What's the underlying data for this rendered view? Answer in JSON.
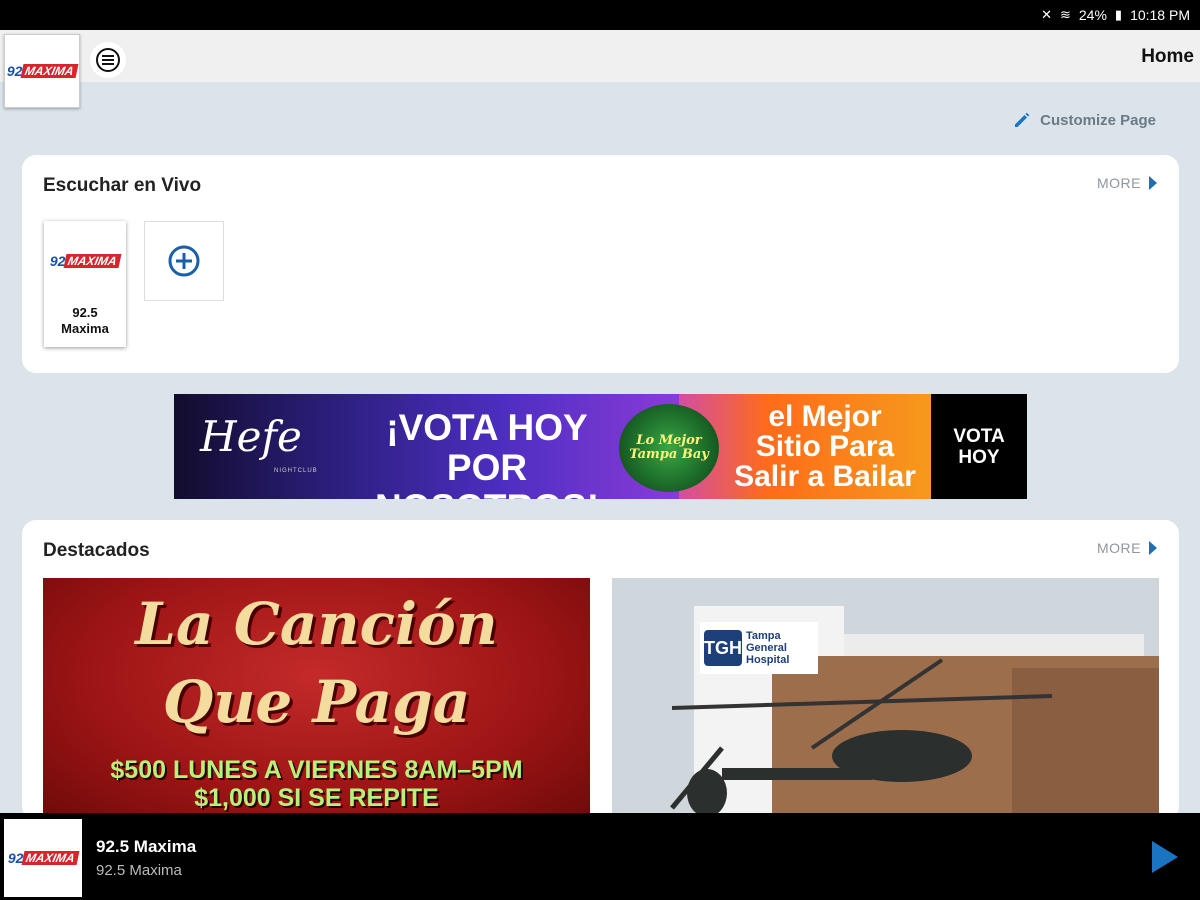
{
  "status_bar": {
    "battery": "24%",
    "time": "10:18 PM"
  },
  "header": {
    "title": "Home",
    "logo_text": "92",
    "logo_brand": "MAXIMA"
  },
  "customize": {
    "label": "Customize Page"
  },
  "live_section": {
    "title": "Escuchar en Vivo",
    "more_label": "MORE",
    "station": {
      "name_line1": "92.5",
      "name_line2": "Maxima"
    }
  },
  "banner": {
    "brand": "Hefe",
    "brand_sub": "NIGHTCLUB",
    "headline_line1": "¡VOTA HOY",
    "headline_line2": "POR NOSOTROS!",
    "badge_line1": "Lo Mejor",
    "badge_line2": "Tampa Bay",
    "mejor_line1": "el Mejor",
    "mejor_line2": "Sitio Para",
    "mejor_line3": "Salir a Bailar",
    "cta_line1": "VOTA",
    "cta_line2": "HOY"
  },
  "featured_section": {
    "title": "Destacados",
    "more_label": "MORE",
    "card1": {
      "title_line1": "La Canción",
      "title_line2": "Que Paga",
      "promo_line1": "$500 LUNES A VIERNES 8AM–5PM",
      "promo_line2": "$1,000 SI SE REPITE"
    },
    "card2": {
      "sign_logo": "TGH",
      "sign_name": "Tampa General Hospital"
    }
  },
  "player": {
    "title": "92.5 Maxima",
    "subtitle": "92.5 Maxima"
  },
  "colors": {
    "accent": "#1a74c2",
    "background": "#dbe4ea",
    "player": "#000000"
  }
}
